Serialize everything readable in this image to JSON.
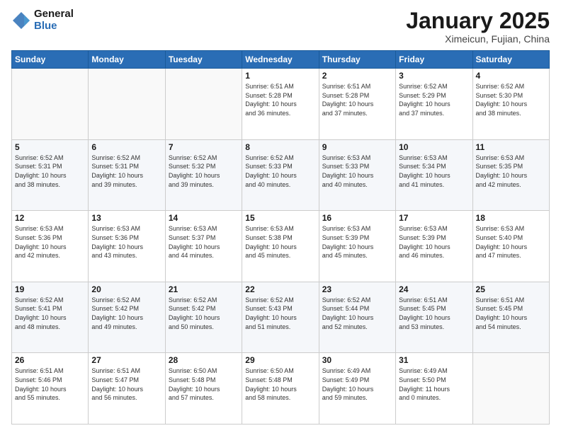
{
  "header": {
    "logo_line1": "General",
    "logo_line2": "Blue",
    "month_title": "January 2025",
    "location": "Ximeicun, Fujian, China"
  },
  "weekdays": [
    "Sunday",
    "Monday",
    "Tuesday",
    "Wednesday",
    "Thursday",
    "Friday",
    "Saturday"
  ],
  "weeks": [
    [
      {
        "day": "",
        "info": ""
      },
      {
        "day": "",
        "info": ""
      },
      {
        "day": "",
        "info": ""
      },
      {
        "day": "1",
        "info": "Sunrise: 6:51 AM\nSunset: 5:28 PM\nDaylight: 10 hours\nand 36 minutes."
      },
      {
        "day": "2",
        "info": "Sunrise: 6:51 AM\nSunset: 5:28 PM\nDaylight: 10 hours\nand 37 minutes."
      },
      {
        "day": "3",
        "info": "Sunrise: 6:52 AM\nSunset: 5:29 PM\nDaylight: 10 hours\nand 37 minutes."
      },
      {
        "day": "4",
        "info": "Sunrise: 6:52 AM\nSunset: 5:30 PM\nDaylight: 10 hours\nand 38 minutes."
      }
    ],
    [
      {
        "day": "5",
        "info": "Sunrise: 6:52 AM\nSunset: 5:31 PM\nDaylight: 10 hours\nand 38 minutes."
      },
      {
        "day": "6",
        "info": "Sunrise: 6:52 AM\nSunset: 5:31 PM\nDaylight: 10 hours\nand 39 minutes."
      },
      {
        "day": "7",
        "info": "Sunrise: 6:52 AM\nSunset: 5:32 PM\nDaylight: 10 hours\nand 39 minutes."
      },
      {
        "day": "8",
        "info": "Sunrise: 6:52 AM\nSunset: 5:33 PM\nDaylight: 10 hours\nand 40 minutes."
      },
      {
        "day": "9",
        "info": "Sunrise: 6:53 AM\nSunset: 5:33 PM\nDaylight: 10 hours\nand 40 minutes."
      },
      {
        "day": "10",
        "info": "Sunrise: 6:53 AM\nSunset: 5:34 PM\nDaylight: 10 hours\nand 41 minutes."
      },
      {
        "day": "11",
        "info": "Sunrise: 6:53 AM\nSunset: 5:35 PM\nDaylight: 10 hours\nand 42 minutes."
      }
    ],
    [
      {
        "day": "12",
        "info": "Sunrise: 6:53 AM\nSunset: 5:36 PM\nDaylight: 10 hours\nand 42 minutes."
      },
      {
        "day": "13",
        "info": "Sunrise: 6:53 AM\nSunset: 5:36 PM\nDaylight: 10 hours\nand 43 minutes."
      },
      {
        "day": "14",
        "info": "Sunrise: 6:53 AM\nSunset: 5:37 PM\nDaylight: 10 hours\nand 44 minutes."
      },
      {
        "day": "15",
        "info": "Sunrise: 6:53 AM\nSunset: 5:38 PM\nDaylight: 10 hours\nand 45 minutes."
      },
      {
        "day": "16",
        "info": "Sunrise: 6:53 AM\nSunset: 5:39 PM\nDaylight: 10 hours\nand 45 minutes."
      },
      {
        "day": "17",
        "info": "Sunrise: 6:53 AM\nSunset: 5:39 PM\nDaylight: 10 hours\nand 46 minutes."
      },
      {
        "day": "18",
        "info": "Sunrise: 6:53 AM\nSunset: 5:40 PM\nDaylight: 10 hours\nand 47 minutes."
      }
    ],
    [
      {
        "day": "19",
        "info": "Sunrise: 6:52 AM\nSunset: 5:41 PM\nDaylight: 10 hours\nand 48 minutes."
      },
      {
        "day": "20",
        "info": "Sunrise: 6:52 AM\nSunset: 5:42 PM\nDaylight: 10 hours\nand 49 minutes."
      },
      {
        "day": "21",
        "info": "Sunrise: 6:52 AM\nSunset: 5:42 PM\nDaylight: 10 hours\nand 50 minutes."
      },
      {
        "day": "22",
        "info": "Sunrise: 6:52 AM\nSunset: 5:43 PM\nDaylight: 10 hours\nand 51 minutes."
      },
      {
        "day": "23",
        "info": "Sunrise: 6:52 AM\nSunset: 5:44 PM\nDaylight: 10 hours\nand 52 minutes."
      },
      {
        "day": "24",
        "info": "Sunrise: 6:51 AM\nSunset: 5:45 PM\nDaylight: 10 hours\nand 53 minutes."
      },
      {
        "day": "25",
        "info": "Sunrise: 6:51 AM\nSunset: 5:45 PM\nDaylight: 10 hours\nand 54 minutes."
      }
    ],
    [
      {
        "day": "26",
        "info": "Sunrise: 6:51 AM\nSunset: 5:46 PM\nDaylight: 10 hours\nand 55 minutes."
      },
      {
        "day": "27",
        "info": "Sunrise: 6:51 AM\nSunset: 5:47 PM\nDaylight: 10 hours\nand 56 minutes."
      },
      {
        "day": "28",
        "info": "Sunrise: 6:50 AM\nSunset: 5:48 PM\nDaylight: 10 hours\nand 57 minutes."
      },
      {
        "day": "29",
        "info": "Sunrise: 6:50 AM\nSunset: 5:48 PM\nDaylight: 10 hours\nand 58 minutes."
      },
      {
        "day": "30",
        "info": "Sunrise: 6:49 AM\nSunset: 5:49 PM\nDaylight: 10 hours\nand 59 minutes."
      },
      {
        "day": "31",
        "info": "Sunrise: 6:49 AM\nSunset: 5:50 PM\nDaylight: 11 hours\nand 0 minutes."
      },
      {
        "day": "",
        "info": ""
      }
    ]
  ]
}
